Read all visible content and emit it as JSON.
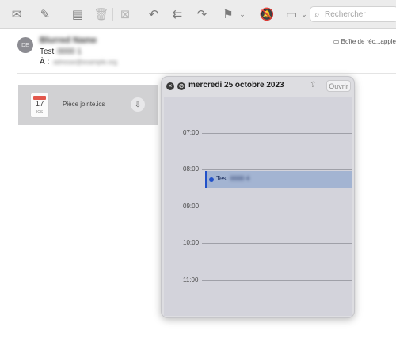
{
  "toolbar": {
    "buttons": [
      "mail-icon",
      "compose-icon",
      "archive-icon",
      "trash-icon",
      "junk-icon",
      "reply-icon",
      "reply-all-icon",
      "forward-icon",
      "flag-icon",
      "chevron-down-icon",
      "mute-icon",
      "move-icon"
    ],
    "search_icon": "⌕",
    "search_placeholder": "Rechercher"
  },
  "message": {
    "avatar_initials": "DE",
    "sender": "Blurred Name",
    "subject_label": "Test",
    "subject_blurred": "0000 1",
    "to_label": "À :",
    "to_address": "adresse@example.org",
    "mailbox": "Boîte de réc...apple"
  },
  "attachment": {
    "icon_day": "17",
    "icon_ext": "ICS",
    "name": "Pièce jointe.ics",
    "save_icon": "⇩"
  },
  "popover": {
    "date_title": "mercredi 25 octobre 2023",
    "close_icon": "×",
    "decline_icon": "⊘",
    "share_icon": "⇪",
    "open_label": "Ouvrir",
    "hours": [
      "07:00",
      "08:00",
      "09:00",
      "10:00",
      "11:00"
    ],
    "event": {
      "title": "Test",
      "blurred": "0000 4",
      "color": "#2251c9"
    }
  }
}
